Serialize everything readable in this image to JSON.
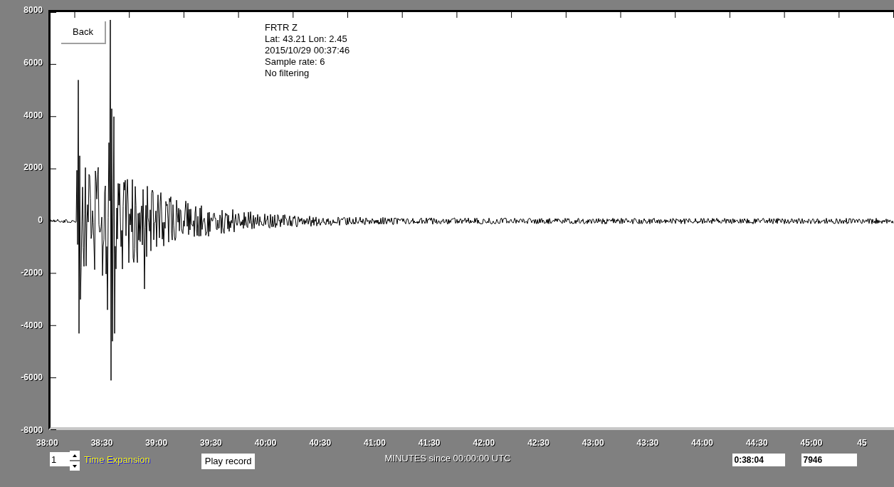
{
  "back_button": "Back",
  "station_info": [
    "FRTR  Z",
    "Lat: 43.21 Lon: 2.45",
    "2015/10/29 00:37:46",
    "Sample rate: 6",
    "No filtering"
  ],
  "y_axis_labels": [
    "8000",
    "6000",
    "4000",
    "2000",
    "0",
    "-2000",
    "-4000",
    "-6000",
    "-8000"
  ],
  "x_axis_labels": [
    "38:00",
    "38:30",
    "39:00",
    "39:30",
    "40:00",
    "40:30",
    "41:00",
    "41:30",
    "42:00",
    "42:30",
    "43:00",
    "43:30",
    "44:00",
    "44:30",
    "45:00",
    "45"
  ],
  "x_axis_title": "MINUTES since 00:00:00 UTC",
  "time_expansion": {
    "value": "1",
    "label": "Time Expansion"
  },
  "play_button": "Play record",
  "time_field": {
    "value": "0:38:04"
  },
  "count_field": {
    "value": "7946"
  }
}
